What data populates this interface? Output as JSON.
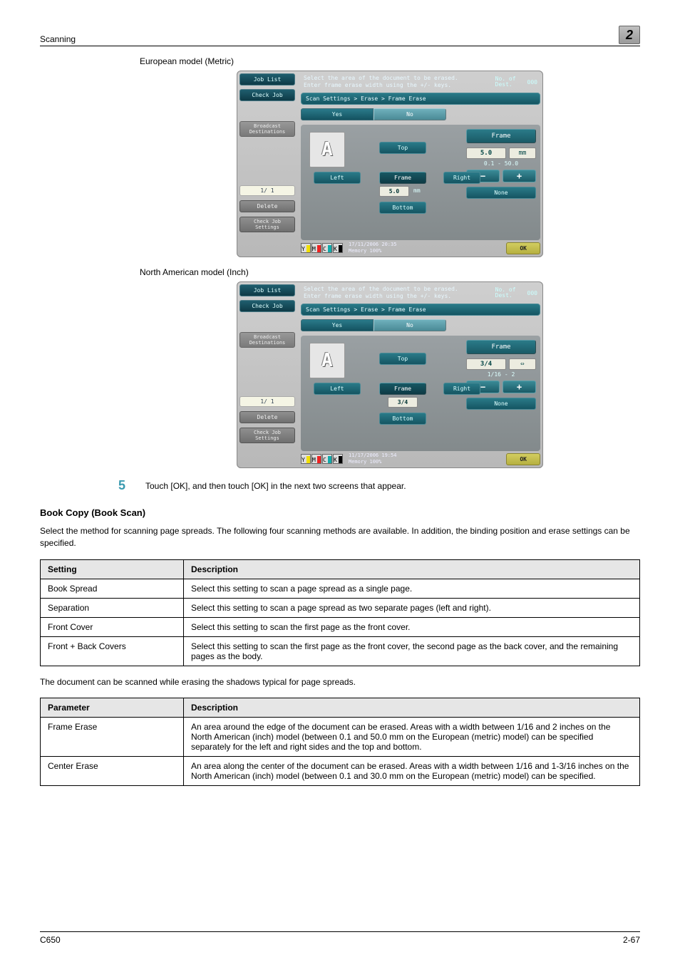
{
  "header": {
    "left": "Scanning",
    "right": "2"
  },
  "captions": {
    "metric": "European model (Metric)",
    "inch": "North American model (Inch)"
  },
  "panel": {
    "job_list": "Job List",
    "check_job": "Check Job",
    "broadcast": "Broadcast\nDestinations",
    "pager": "1/  1",
    "delete": "Delete",
    "check_settings": "Check Job\nSettings",
    "msg_l1": "Select the area of the document to be erased.",
    "msg_l2": "Enter frame erase width using the +/- keys.",
    "dest_label": "No. of\nDest.",
    "dest_count": "000",
    "breadcrumb": "Scan Settings > Erase > Frame Erase",
    "yes": "Yes",
    "no": "No",
    "top": "Top",
    "left": "Left",
    "right": "Right",
    "frame": "Frame",
    "bottom": "Bottom",
    "none": "None",
    "ok": "OK",
    "mm_unit": "mm",
    "mm_val": "5.0",
    "mm_range": "0.1  -  50.0",
    "inch_val": "3/4",
    "inch_unit": "⇔",
    "inch_range": "1/16  -  2",
    "inch_center": "3/4",
    "toner": {
      "y": "Y",
      "m": "M",
      "c": "C",
      "k": "K"
    },
    "dt_metric": "17/11/2006    20:35",
    "dt_inch": "11/17/2006    19:54",
    "mem": "Memory        100%"
  },
  "step": {
    "num": "5",
    "text": "Touch [OK], and then touch [OK] in the next two screens that appear."
  },
  "section": {
    "title": "Book Copy (Book Scan)",
    "intro": "Select the method for scanning page spreads. The following four scanning methods are available. In addition, the binding position and erase settings can be specified."
  },
  "table1": {
    "h1": "Setting",
    "h2": "Description",
    "rows": [
      {
        "c1": "Book Spread",
        "c2": "Select this setting to scan a page spread as a single page."
      },
      {
        "c1": "Separation",
        "c2": "Select this setting to scan a page spread as two separate pages (left and right)."
      },
      {
        "c1": "Front Cover",
        "c2": "Select this setting to scan the first page as the front cover."
      },
      {
        "c1": "Front + Back Covers",
        "c2": "Select this setting to scan the first page as the front cover, the second page as the back cover, and the remaining pages as the body."
      }
    ]
  },
  "mid_text": "The document can be scanned while erasing the shadows typical for page spreads.",
  "table2": {
    "h1": "Parameter",
    "h2": "Description",
    "rows": [
      {
        "c1": "Frame Erase",
        "c2": "An area around the edge of the document can be erased. Areas with a width between 1/16 and 2 inches on the North American (inch) model (between 0.1 and 50.0 mm on the European (metric) model) can be specified separately for the left and right sides and the top and bottom."
      },
      {
        "c1": "Center Erase",
        "c2": "An area along the center of the document can be erased. Areas with a width between 1/16 and 1-3/16 inches on the North American (inch) model (between 0.1 and 30.0 mm on the European (metric) model) can be specified."
      }
    ]
  },
  "footer": {
    "left": "C650",
    "right": "2-67"
  }
}
